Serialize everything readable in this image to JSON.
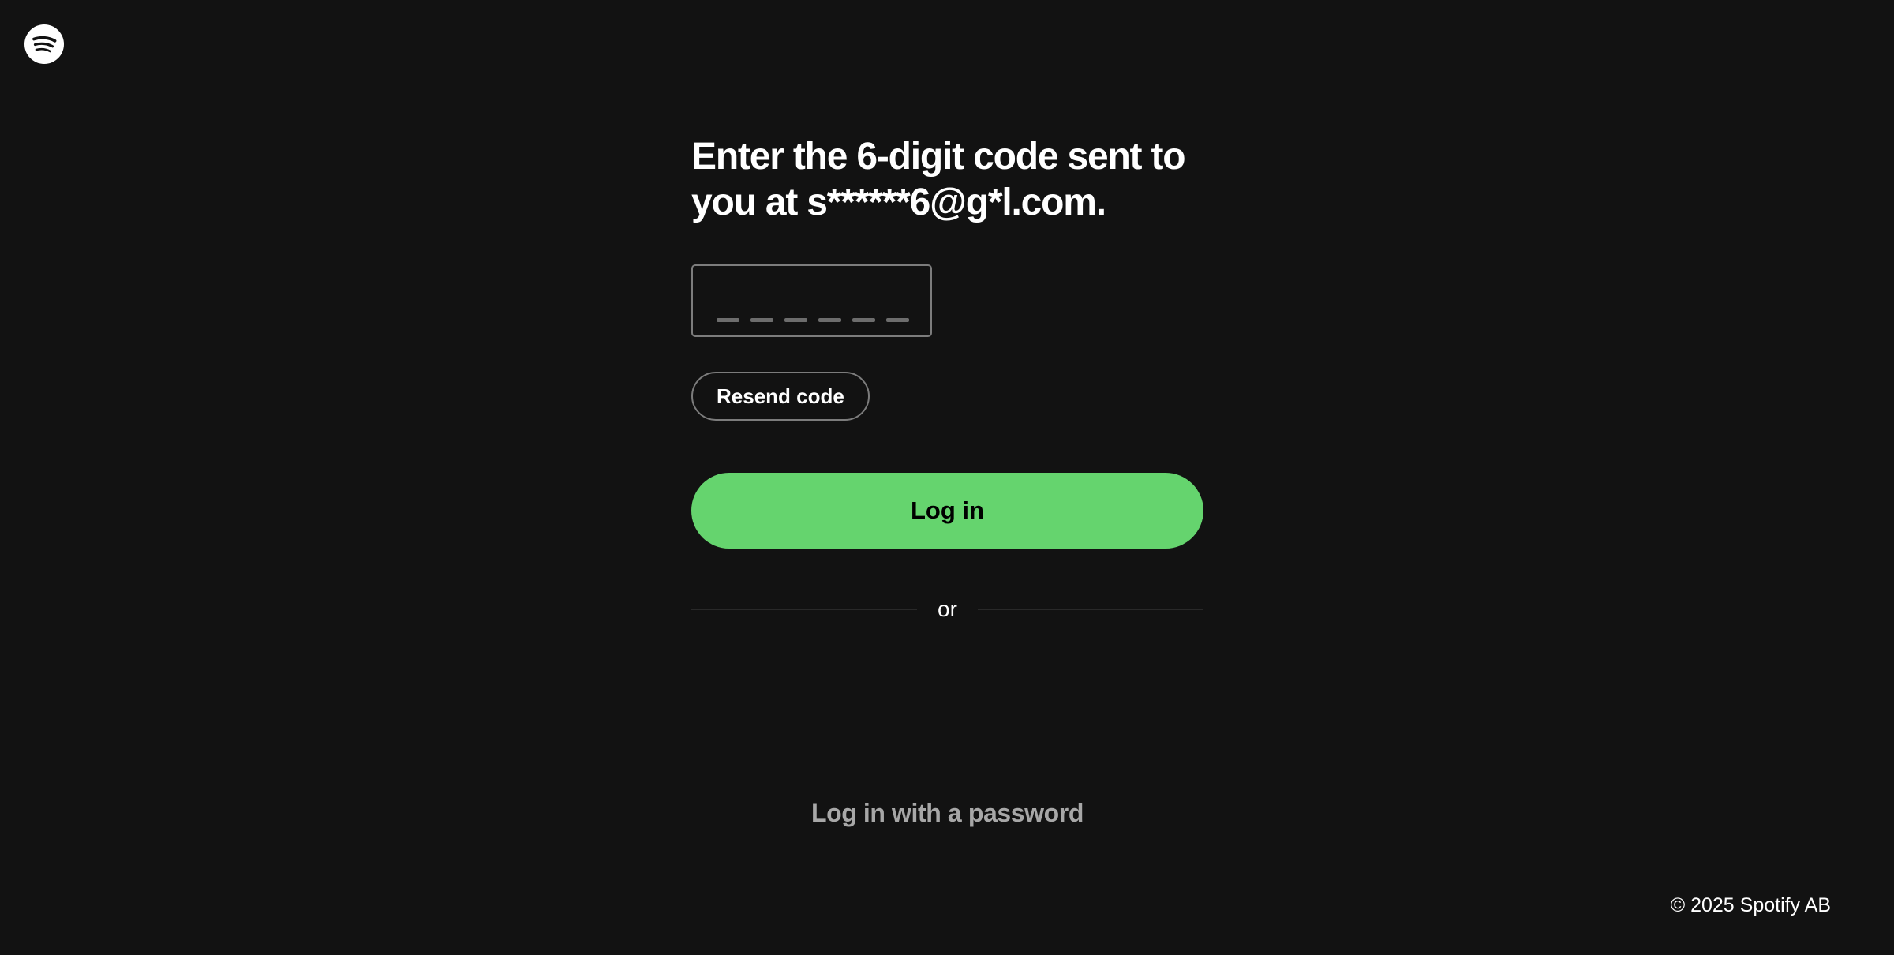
{
  "header": {
    "logo_icon": "spotify-logo-icon"
  },
  "verify": {
    "heading": "Enter the 6-digit code sent to you at s******6@g*l.com.",
    "code_input": {
      "value": "",
      "digits": 6
    },
    "resend_label": "Resend code",
    "login_label": "Log in",
    "divider_text": "or",
    "password_link_label": "Log in with a password"
  },
  "footer": {
    "copyright": "© 2025 Spotify AB"
  },
  "colors": {
    "background": "#121212",
    "accent": "#65d46e",
    "text": "#ffffff",
    "muted_text": "#a7a7a7",
    "border": "#7c7c7c"
  }
}
